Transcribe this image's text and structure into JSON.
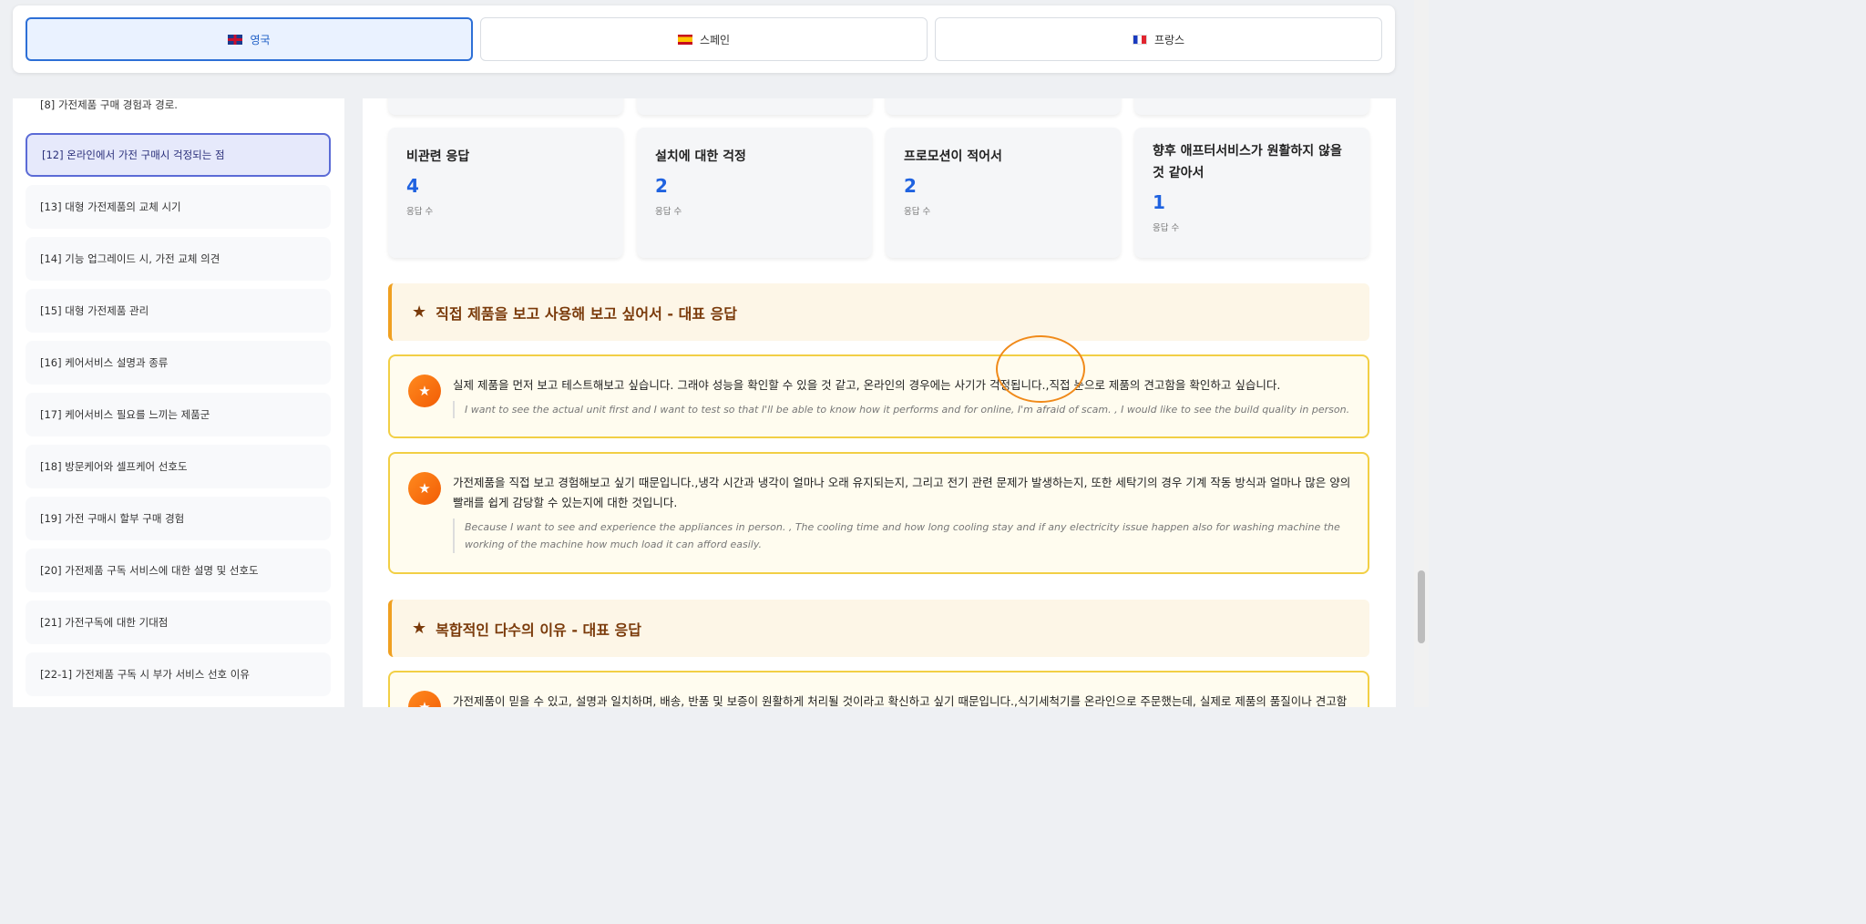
{
  "tabs": [
    {
      "label": "영국",
      "flag": "uk-flag-icon",
      "active": true
    },
    {
      "label": "스페인",
      "flag": "spain-flag-icon",
      "active": false
    },
    {
      "label": "프랑스",
      "flag": "france-flag-icon",
      "active": false
    }
  ],
  "sidebar": {
    "items": [
      {
        "label": "[8] 가전제품 구매 경험과 경로."
      },
      {
        "label": "[12] 온라인에서 가전 구매시 걱정되는 점"
      },
      {
        "label": "[13] 대형 가전제품의 교체 시기"
      },
      {
        "label": "[14] 기능 업그레이드 시, 가전 교체 의견"
      },
      {
        "label": "[15] 대형 가전제품 관리"
      },
      {
        "label": "[16] 케어서비스 설명과 종류"
      },
      {
        "label": "[17] 케어서비스 필요를 느끼는 제품군"
      },
      {
        "label": "[18] 방문케어와 셀프케어 선호도"
      },
      {
        "label": "[19] 가전 구매시 할부 구매 경험"
      },
      {
        "label": "[20] 가전제품 구독 서비스에 대한 설명 및 선호도"
      },
      {
        "label": "[21] 가전구독에 대한 기대점"
      },
      {
        "label": "[22-1] 가전제품 구독 시 부가 서비스 선호 이유"
      }
    ]
  },
  "stats": [
    {
      "title": "비관련 응답",
      "value": "4",
      "sub": "응답 수"
    },
    {
      "title": "설치에 대한 걱정",
      "value": "2",
      "sub": "응답 수"
    },
    {
      "title": "프로모션이 적어서",
      "value": "2",
      "sub": "응답 수"
    },
    {
      "title": "향후 애프터서비스가 원활하지 않을 것 같아서",
      "value": "1",
      "sub": "응답 수"
    }
  ],
  "sections": [
    {
      "heading": "직접 제품을 보고 사용해 보고 싶어서 - 대표 응답",
      "responses": [
        {
          "ko": "실제 제품을 먼저 보고 테스트해보고 싶습니다. 그래야 성능을 확인할 수 있을 것 같고, 온라인의 경우에는 사기가 걱정됩니다.,직접 눈으로 제품의 견고함을 확인하고 싶습니다.",
          "en": "I want to see the actual unit first and I want to test so that I'll be able to know how it performs and for online, I'm afraid of scam. , I would like to see the build quality in person."
        },
        {
          "ko": "가전제품을 직접 보고 경험해보고 싶기 때문입니다.,냉각 시간과 냉각이 얼마나 오래 유지되는지, 그리고 전기 관련 문제가 발생하는지, 또한 세탁기의 경우 기계 작동 방식과 얼마나 많은 양의 빨래를 쉽게 감당할 수 있는지에 대한 것입니다.",
          "en": "Because I want to see and experience the appliances in person. , The cooling time and how long cooling stay and if any electricity issue happen also for washing machine the working of the machine how much load it can afford easily."
        }
      ]
    },
    {
      "heading": "복합적인 다수의 이유 - 대표 응답",
      "responses": [
        {
          "ko": "가전제품이 믿을 수 있고, 설명과 일치하며, 배송, 반품 및 보증이 원활하게 처리될 것이라고 확신하고 싶기 때문입니다.,식기세척기를 온라인으로 주문했는데, 실제로 제품의 품질이나 견고함"
        }
      ]
    }
  ],
  "icons": {
    "star": "★"
  },
  "colors": {
    "accent": "#1f62e0",
    "active_tab": "#2d6fd6",
    "section_text": "#7a3a0a",
    "card_border": "#f2cf45",
    "icon_orange": "#f25c05"
  }
}
